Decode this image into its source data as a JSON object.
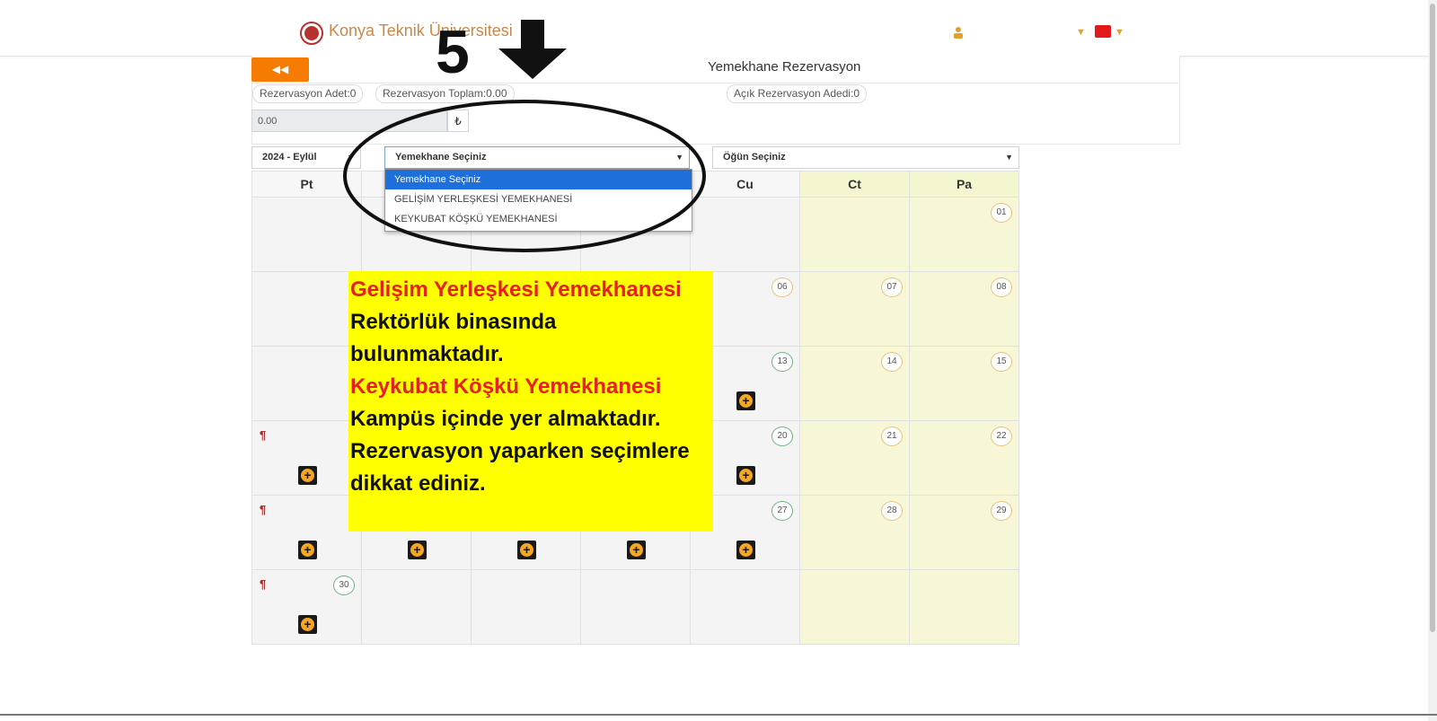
{
  "header": {
    "university_name": "Konya Teknik Üniversitesi"
  },
  "panel": {
    "title": "Yemekhane Rezervasyon",
    "back_icon": "◀◀",
    "rez_adet": "Rezervasyon Adet:0",
    "rez_toplam": "Rezervasyon Toplam:0.00",
    "acik_rez": "Açık Rezervasyon Adedi:0",
    "total_value": "0.00",
    "currency_symbol": "₺"
  },
  "filters": {
    "month": "2024 - Eylül",
    "meal_hall": "Yemekhane Seçiniz",
    "ogun": "Öğün Seçiniz"
  },
  "dropdown": {
    "options": [
      "Yemekhane Seçiniz",
      "GELİŞİM YERLEŞKESİ YEMEKHANESİ",
      "KEYKUBAT KÖŞKÜ YEMEKHANESİ"
    ],
    "selected": "Yemekhane Seçiniz"
  },
  "calendar": {
    "days": [
      "Pt",
      "",
      "",
      "",
      "Cu",
      "Ct",
      "Pa"
    ],
    "rows": [
      [
        "",
        "",
        "",
        "",
        "",
        "",
        "01"
      ],
      [
        "",
        "",
        "",
        "",
        "06",
        "07",
        "08"
      ],
      [
        "",
        "",
        "",
        "",
        "13",
        "14",
        "15"
      ],
      [
        "",
        "",
        "",
        "",
        "20",
        "21",
        "22"
      ],
      [
        "",
        "",
        "",
        "",
        "27",
        "28",
        "29"
      ],
      [
        "30",
        "",
        "",
        "",
        "",
        "",
        ""
      ]
    ]
  },
  "annotation": {
    "step_number": "5",
    "note_red_1": "Gelişim Yerleşkesi Yemekhanesi",
    "note_black_1": " Rektörlük binasında bulunmaktadır.",
    "note_red_2": "Keykubat Köşkü Yemekhanesi",
    "note_black_2": " Kampüs içinde yer almaktadır. Rezervasyon yaparken seçimlere dikkat ediniz."
  },
  "colors": {
    "accent_orange": "#f57c00",
    "weekend_bg": "#f7f7d8",
    "highlight_yellow": "#ffff00",
    "note_red": "#e62020",
    "dropdown_active": "#1e6fd9"
  },
  "icons": {
    "back": "double-chevron-left-icon",
    "add": "plus-circle-icon",
    "meal": "fork-knife-icon",
    "user": "user-icon",
    "flag": "turkish-flag-icon"
  }
}
